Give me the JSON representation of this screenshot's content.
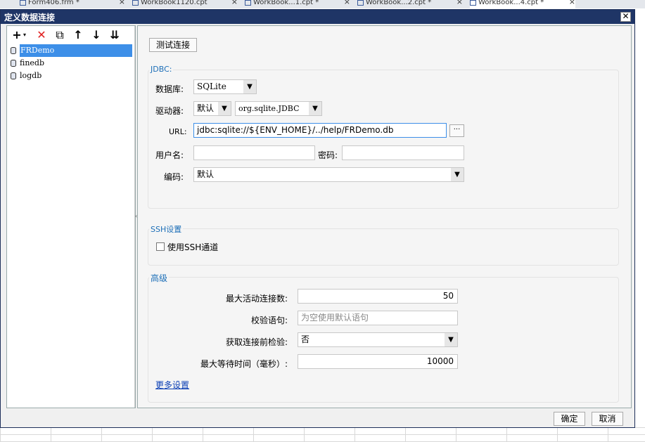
{
  "tabs": [
    {
      "label": "Form406.frm *"
    },
    {
      "label": "WorkBook1120.cpt"
    },
    {
      "label": "WorkBook...1.cpt *"
    },
    {
      "label": "WorkBook...2.cpt *"
    },
    {
      "label": "WorkBook...4.cpt *"
    }
  ],
  "dialog": {
    "title": "定义数据连接",
    "close": "✕"
  },
  "toolbar": {
    "add": "+",
    "delete": "✕",
    "copy": "⧉",
    "up": "↑",
    "down": "↓",
    "sort": "⇊"
  },
  "connections": [
    {
      "label": "FRDemo",
      "selected": true
    },
    {
      "label": "finedb"
    },
    {
      "label": "logdb"
    }
  ],
  "test_button": "测试连接",
  "jdbc": {
    "title": "JDBC:",
    "database_label": "数据库:",
    "database_value": "SQLite",
    "driver_label": "驱动器:",
    "driver_mode": "默认",
    "driver_class": "org.sqlite.JDBC",
    "url_label": "URL:",
    "url_value": "jdbc:sqlite://${ENV_HOME}/../help/FRDemo.db",
    "url_more": "···",
    "username_label": "用户名:",
    "username_value": "",
    "password_label": "密码:",
    "password_value": "",
    "encoding_label": "编码:",
    "encoding_value": "默认"
  },
  "ssh": {
    "title": "SSH设置",
    "use_ssh_label": "使用SSH通道",
    "use_ssh_checked": false
  },
  "advanced": {
    "title": "高级",
    "max_active_label": "最大活动连接数:",
    "max_active_value": "50",
    "validation_label": "校验语句:",
    "validation_placeholder": "为空使用默认语句",
    "test_before_label": "获取连接前检验:",
    "test_before_value": "否",
    "max_wait_label": "最大等待时间（毫秒）:",
    "max_wait_value": "10000",
    "more_settings": "更多设置"
  },
  "footer": {
    "ok": "确定",
    "cancel": "取消"
  },
  "icons": {
    "dropdown": "chevron-down-icon",
    "database": "database-icon"
  },
  "colors": {
    "titlebar": "#1f3566",
    "selection": "#3d8fe8",
    "group_title": "#1d6fb8",
    "link": "#0b3fb5"
  }
}
